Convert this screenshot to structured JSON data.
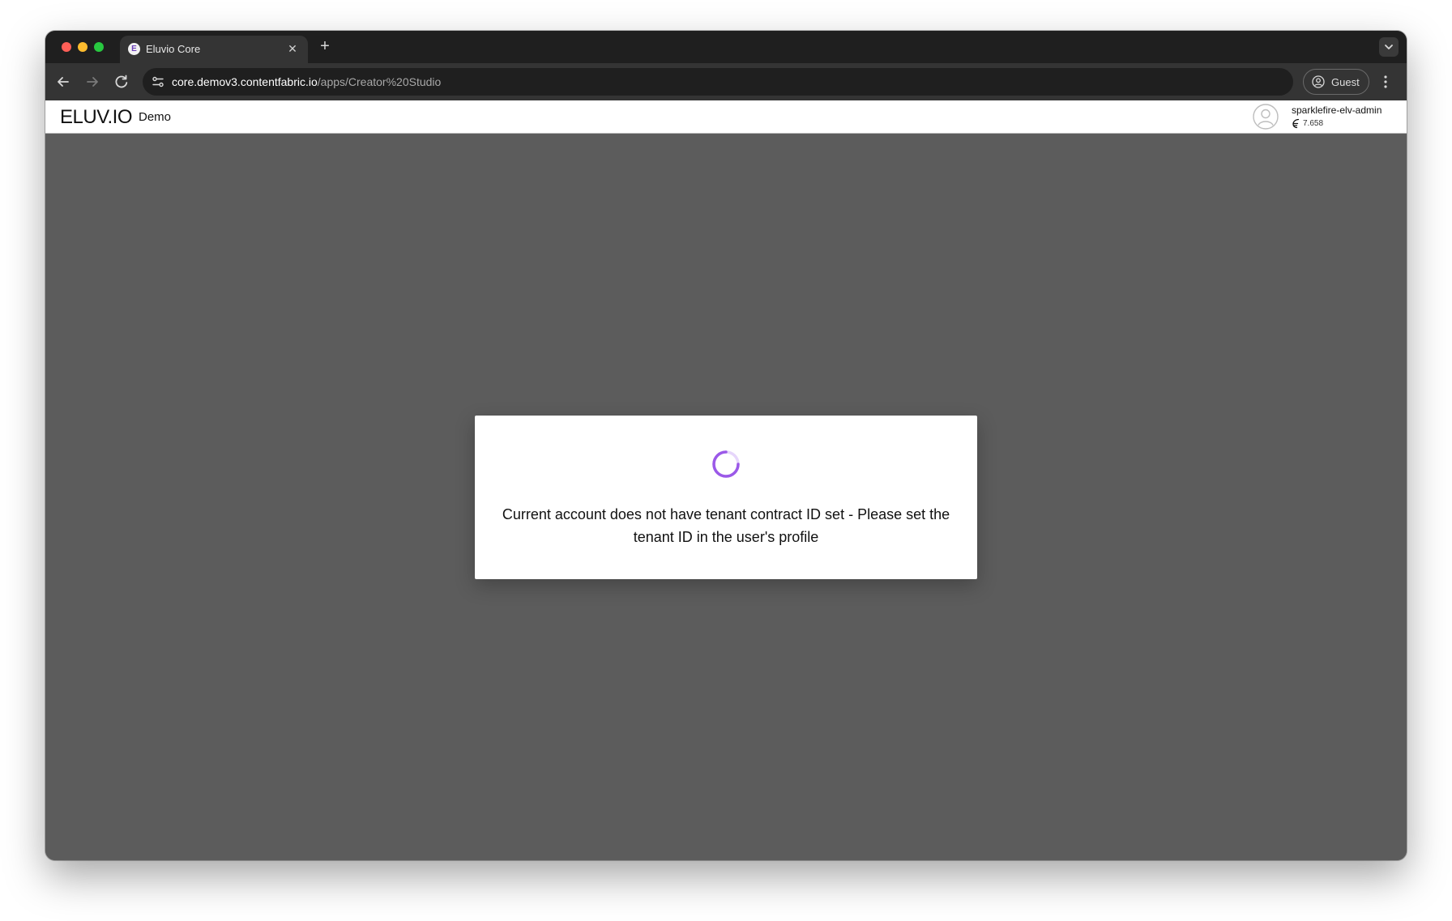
{
  "browser": {
    "tab": {
      "favicon_letter": "E",
      "title": "Eluvio Core",
      "close_glyph": "✕"
    },
    "new_tab_glyph": "+",
    "address_bar": {
      "host": "core.demov3.contentfabric.io",
      "path": "/apps/Creator%20Studio"
    },
    "profile_label": "Guest",
    "icons": {
      "back": "arrow-left-icon",
      "forward": "arrow-right-icon",
      "reload": "reload-icon",
      "site_info": "tune-icon",
      "profile": "person-circle-icon",
      "menu": "kebab-menu-icon",
      "tab_list": "chevron-down-icon"
    }
  },
  "app_header": {
    "logo": "ELUV.IO",
    "environment": "Demo",
    "account": {
      "name": "sparklefire-elv-admin",
      "balance": "7.658",
      "balance_icon": "fabric-token-icon",
      "avatar_icon": "user-avatar-icon"
    }
  },
  "modal": {
    "message": "Current account does not have tenant contract ID set - Please set the tenant ID in the user's profile",
    "spinner_icon": "loading-spinner-icon"
  },
  "colors": {
    "content_background": "#5c5c5c",
    "browser_chrome": "#1f1f1f",
    "toolbar": "#343434",
    "spinner_accent": "#9b59e8"
  }
}
